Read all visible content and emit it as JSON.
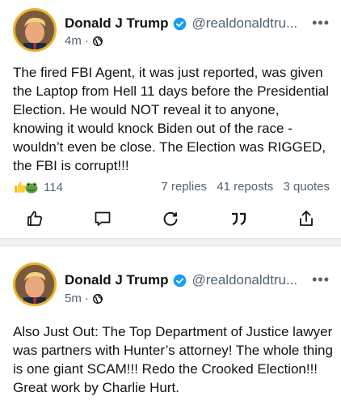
{
  "post1": {
    "display_name": "Donald J Trump",
    "handle": "@realdonaldtru...",
    "time": "4m",
    "separator": "·",
    "text": "The fired FBI Agent, it was just reported, was given the Laptop from Hell 11 days before the Presidential Election. He would NOT reveal it to anyone, knowing it would knock Biden out of the race - wouldn’t even be close. The Election was RIGGED, the FBI is corrupt!!!",
    "reaction_count": "114",
    "replies": "7 replies",
    "reposts": "41 reposts",
    "quotes": "3 quotes",
    "more_label": "•••"
  },
  "post2": {
    "display_name": "Donald J Trump",
    "handle": "@realdonaldtru...",
    "time": "5m",
    "separator": "·",
    "text": "Also Just Out: The Top Department of Justice lawyer was partners with Hunter’s attorney! The whole thing is one giant SCAM!!! Redo the Crooked Election!!! Great work by Charlie Hurt.",
    "more_label": "•••"
  },
  "colors": {
    "verified": "#1d9bf0",
    "secondary_text": "#536471",
    "avatar_ring": "#e8b52a"
  },
  "icons": {
    "actions": [
      "like-icon",
      "reply-icon",
      "repost-icon",
      "quote-icon",
      "share-icon"
    ],
    "reactions": [
      "thumbs-up-emoji",
      "frog-emoji"
    ]
  }
}
